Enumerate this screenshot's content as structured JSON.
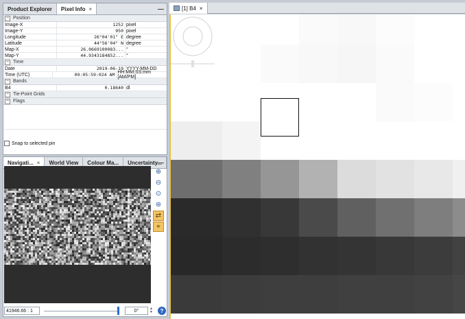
{
  "left_top_panel": {
    "tabs": [
      {
        "label": "Product Explorer"
      },
      {
        "label": "Pixel Info",
        "close": "×"
      }
    ],
    "minimize": "—",
    "position_section": "Position",
    "position_rows": [
      {
        "name": "Image-X",
        "value": "1252",
        "unit": "pixel"
      },
      {
        "name": "Image-Y",
        "value": "950",
        "unit": "pixel"
      },
      {
        "name": "Longitude",
        "value": "26°04'01\" E",
        "unit": "degree"
      },
      {
        "name": "Latitude",
        "value": "44°56'04\" N",
        "unit": "degree"
      },
      {
        "name": "Map-X",
        "value": "26.0669100083...",
        "unit": "°"
      },
      {
        "name": "Map-Y",
        "value": "44.9343184852...",
        "unit": "°"
      }
    ],
    "time_section": "Time",
    "time_rows": [
      {
        "name": "Date",
        "value": "2019-06-19",
        "unit": "YYYY-MM-DD"
      },
      {
        "name": "Time (UTC)",
        "value": "09:05:59:024 AM",
        "unit": "HH:MM:SS:mm [AM/PM]"
      }
    ],
    "bands_section": "Bands",
    "band_rows": [
      {
        "name": "B4",
        "value": "0.18640",
        "unit": "dl"
      }
    ],
    "tie_point_section": "Tie-Point Grids",
    "flags_section": "Flags",
    "snap_label": "Snap to selected pin"
  },
  "left_bottom_panel": {
    "tabs": [
      {
        "label": "Navigati...",
        "close": "×"
      },
      {
        "label": "World View"
      },
      {
        "label": "Colour Ma..."
      },
      {
        "label": "Uncertainty..."
      }
    ],
    "minimize": "—",
    "tools": [
      {
        "icon": "zoom-in-icon",
        "glyph": "⊕"
      },
      {
        "icon": "zoom-out-icon",
        "glyph": "⊖"
      },
      {
        "icon": "zoom-pixel-icon",
        "glyph": "⊙"
      },
      {
        "icon": "zoom-all-icon",
        "glyph": "⊛"
      },
      {
        "icon": "sync-views-icon",
        "glyph": "⇄"
      },
      {
        "icon": "sync-cursor-icon",
        "glyph": "⌖"
      }
    ],
    "scale_value": "41946.66 : 1",
    "angle_value": "0°",
    "help": "?"
  },
  "image_view": {
    "tab_label": "[1] B4",
    "tab_close": "×"
  },
  "colors": {
    "selection_border": "#e2c24a",
    "tool_active": "#f3c463"
  }
}
